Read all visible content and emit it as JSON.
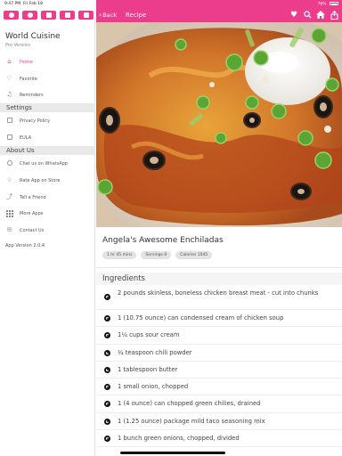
{
  "status": {
    "time": "9:47 PM",
    "date": "Fri Feb 18",
    "battery": "76%"
  },
  "colors": {
    "accent": "#ec3d8c"
  },
  "sidebar": {
    "social_icons": [
      "share-icon",
      "dribbble-icon",
      "twitter-icon",
      "linkedin-icon",
      "youtube-icon"
    ],
    "app_title": "World Cuisine",
    "app_subtitle": "Pro Version",
    "items": [
      {
        "label": "Home",
        "icon": "home-icon"
      },
      {
        "label": "Favorite",
        "icon": "heart-icon"
      },
      {
        "label": "Reminders",
        "icon": "bell-icon"
      }
    ],
    "settings_header": "Settings",
    "settings_items": [
      {
        "label": "Privacy Policy",
        "icon": "document-icon"
      },
      {
        "label": "EULA",
        "icon": "document-icon"
      }
    ],
    "about_header": "About Us",
    "about_items": [
      {
        "label": "Chat us on WhatsApp",
        "icon": "chat-icon"
      },
      {
        "label": "Rate App on Store",
        "icon": "star-icon"
      },
      {
        "label": "Tell a Friend",
        "icon": "share-icon"
      },
      {
        "label": "More Apps",
        "icon": "grid-icon"
      },
      {
        "label": "Contact Us",
        "icon": "mail-icon"
      }
    ],
    "app_version": "App Version 2.0.4"
  },
  "navbar": {
    "back_label": "Back",
    "title": "Recipe",
    "actions": [
      "heart-icon",
      "search-icon",
      "home-icon",
      "share-icon"
    ]
  },
  "recipe": {
    "title": "Angela's Awesome Enchiladas",
    "chips": [
      "1 hr 45 mins",
      "Servings 8",
      "Calories 1045"
    ],
    "ingredients_header": "Ingredients",
    "ingredients": [
      "2 pounds skinless, boneless chicken breast meat - cut into chunks",
      "1 (10.75 ounce) can condensed cream of chicken soup",
      "1¼ cups sour cream",
      "¼ teaspoon chili powder",
      "1 tablespoon butter",
      "1 small onion, chopped",
      "1 (4 ounce) can chopped green chilies, drained",
      "1 (1.25 ounce) package mild taco seasoning mix",
      "1 bunch green onions, chopped, divided"
    ]
  }
}
